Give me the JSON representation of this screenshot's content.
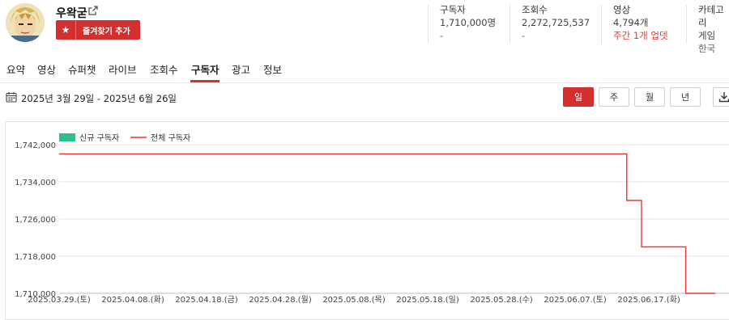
{
  "channel": {
    "name": "우왁굳",
    "favorite_label": "즐겨찾기 추가"
  },
  "stats": [
    {
      "title": "구독자",
      "value": "1,710,000명",
      "sub": "-",
      "sub_red": false
    },
    {
      "title": "조회수",
      "value": "2,272,725,537",
      "sub": "-",
      "sub_red": false
    },
    {
      "title": "영상",
      "value": "4,794개",
      "sub": "주간 1개 업뎃",
      "sub_red": true
    },
    {
      "title": "카테고리",
      "value": "게임",
      "sub": "한국",
      "sub_red": false
    }
  ],
  "tabs": [
    "요약",
    "영상",
    "슈퍼챗",
    "라이브",
    "조회수",
    "구독자",
    "광고",
    "정보"
  ],
  "active_tab": "구독자",
  "date_range": "2025년 3월 29일 - 2025년 6월 26일",
  "periods": [
    "일",
    "주",
    "월",
    "년"
  ],
  "active_period": "일",
  "colors": {
    "accent": "#d32f2f",
    "new_subs": "#2ec08a",
    "total_line": "#e53935"
  },
  "chart_data": {
    "type": "line",
    "legend": [
      "신규 구독자",
      "전체 구독자"
    ],
    "legend_placement": "top-left",
    "x_ticks": [
      "2025.03.29.(토)",
      "2025.04.08.(화)",
      "2025.04.18.(금)",
      "2025.04.28.(월)",
      "2025.05.08.(목)",
      "2025.05.18.(일)",
      "2025.05.28.(수)",
      "2025.06.07.(토)",
      "2025.06.17.(화)"
    ],
    "y_ticks": [
      "1,710,000",
      "1,718,000",
      "1,726,000",
      "1,734,000",
      "1,742,000"
    ],
    "ylim": [
      1710000,
      1742000
    ],
    "xlim": [
      0,
      89
    ],
    "grid": true,
    "series": [
      {
        "name": "전체 구독자",
        "points": [
          [
            0,
            1740000
          ],
          [
            77,
            1740000
          ],
          [
            77,
            1730000
          ],
          [
            78,
            1730000
          ],
          [
            79,
            1730000
          ],
          [
            79,
            1720000
          ],
          [
            80,
            1720000
          ],
          [
            85,
            1720000
          ],
          [
            85,
            1710000
          ],
          [
            86,
            1710000
          ],
          [
            89,
            1710000
          ]
        ]
      }
    ]
  }
}
